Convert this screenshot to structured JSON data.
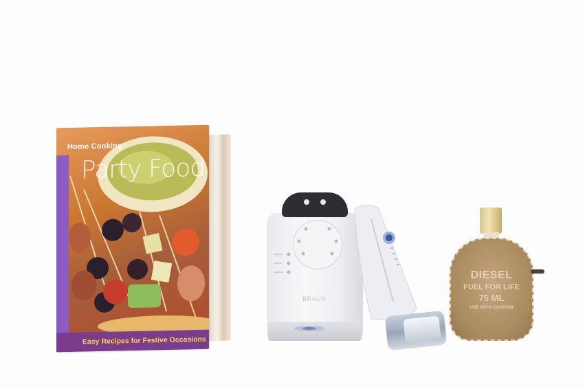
{
  "book": {
    "title_small": "Home Cooking",
    "title_big": "Party Food",
    "subtitle": "Easy Recipes for Festive Occasions"
  },
  "charger": {
    "logo": "BRAUN"
  },
  "perfume": {
    "brand": "DIESEL",
    "name": "FUEL FOR LIFE",
    "volume": "75 ML",
    "tagline": "USE WITH CAUTION"
  },
  "colors": {
    "background": "#fdfdfd",
    "book_band": "#7a3c8d",
    "book_subtitle": "#f7d64a",
    "charger_top": "#2c2e34",
    "perfume_leather": "#a98a5e"
  }
}
